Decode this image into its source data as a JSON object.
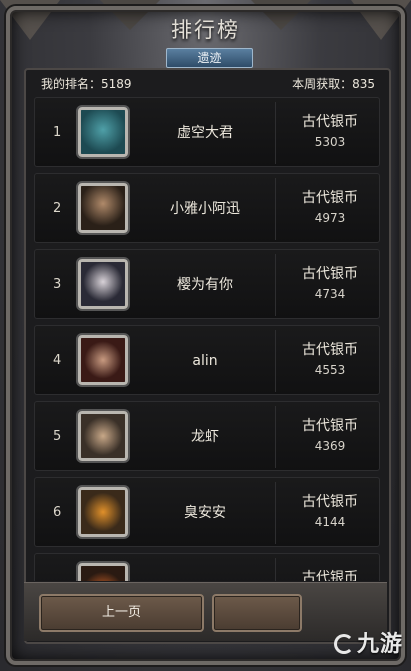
{
  "header": {
    "title": "排行榜",
    "tab_label": "遗迹"
  },
  "stats": {
    "my_rank_label": "我的排名：5189",
    "weekly_gain_label": "本周获取：835"
  },
  "rankings": [
    {
      "rank": "1",
      "name": "虚空大君",
      "reward_label": "古代银币",
      "reward_value": "5303",
      "avatar_color": "#2b6b74"
    },
    {
      "rank": "2",
      "name": "小雅小阿迅",
      "reward_label": "古代银币",
      "reward_value": "4973",
      "avatar_color": "#3e342c"
    },
    {
      "rank": "3",
      "name": "樱为有你",
      "reward_label": "古代银币",
      "reward_value": "4734",
      "avatar_color": "#4a4a58"
    },
    {
      "rank": "4",
      "name": "alin",
      "reward_label": "古代银币",
      "reward_value": "4553",
      "avatar_color": "#5a2a22"
    },
    {
      "rank": "5",
      "name": "龙虾",
      "reward_label": "古代银币",
      "reward_value": "4369",
      "avatar_color": "#5a4a3a"
    },
    {
      "rank": "6",
      "name": "臭安安",
      "reward_label": "古代银币",
      "reward_value": "4144",
      "avatar_color": "#6a4a22"
    },
    {
      "rank": "",
      "name": "",
      "reward_label": "古代银币",
      "reward_value": "",
      "avatar_color": "#7a3a1a"
    }
  ],
  "footer": {
    "prev_label": "上一页",
    "next_label": ""
  },
  "watermark": "九游"
}
